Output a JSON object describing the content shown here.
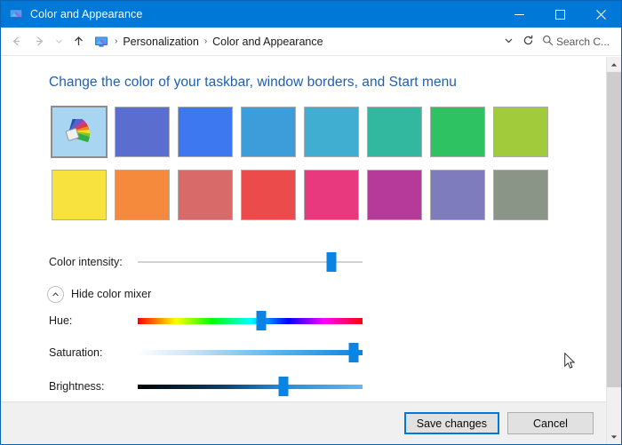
{
  "window": {
    "title": "Color and Appearance",
    "title_icon": "display-monitor-icon",
    "minimize_label": "─",
    "maximize_label": "☐",
    "close_label": "✕"
  },
  "navbar": {
    "back_label": "←",
    "forward_label": "→",
    "recent_label": "⌄",
    "up_label": "↑",
    "crumb_icon": "control-panel-icon",
    "separator": "›",
    "breadcrumbs": [
      "Personalization",
      "Color and Appearance"
    ],
    "dropdown_label": "⌄",
    "refresh_label": "↻",
    "search_icon": "search-icon",
    "search_text": "Search C..."
  },
  "main": {
    "heading": "Change the color of your taskbar, window borders, and Start menu",
    "custom_swatch_name": "custom-color-picker",
    "swatches": [
      {
        "name": "custom",
        "color": "#a8d5f2",
        "selected": true
      },
      {
        "name": "indigo",
        "color": "#5a6ed0",
        "selected": false
      },
      {
        "name": "blue",
        "color": "#3d78f0",
        "selected": false
      },
      {
        "name": "sky-blue",
        "color": "#3d9ddb",
        "selected": false
      },
      {
        "name": "light-blue",
        "color": "#40aed1",
        "selected": false
      },
      {
        "name": "teal",
        "color": "#33b8a0",
        "selected": false
      },
      {
        "name": "green",
        "color": "#2fc262",
        "selected": false
      },
      {
        "name": "lime-green",
        "color": "#a2cb3b",
        "selected": false
      },
      {
        "name": "yellow",
        "color": "#f8e23e",
        "selected": false
      },
      {
        "name": "orange",
        "color": "#f58a3c",
        "selected": false
      },
      {
        "name": "salmon",
        "color": "#d96a6a",
        "selected": false
      },
      {
        "name": "red",
        "color": "#ec4b4b",
        "selected": false
      },
      {
        "name": "pink",
        "color": "#e8397f",
        "selected": false
      },
      {
        "name": "magenta",
        "color": "#b53a99",
        "selected": false
      },
      {
        "name": "purple",
        "color": "#7f7cbd",
        "selected": false
      },
      {
        "name": "sage-gray",
        "color": "#8a9487",
        "selected": false
      }
    ],
    "intensity": {
      "label": "Color intensity:",
      "value_percent": 86,
      "track_color": "#d2d2d2",
      "thumb_color": "#0a84e0"
    },
    "mixer_toggle": {
      "label": "Hide color mixer",
      "icon": "chevron-up-icon",
      "expanded": true
    },
    "mixer_sliders": [
      {
        "name": "hue",
        "label": "Hue:",
        "value_percent": 55,
        "thumb_color": "#0a84e0"
      },
      {
        "name": "saturation",
        "label": "Saturation:",
        "value_percent": 96,
        "thumb_color": "#0a84e0"
      },
      {
        "name": "brightness",
        "label": "Brightness:",
        "value_percent": 65,
        "thumb_color": "#0a84e0"
      }
    ]
  },
  "footer": {
    "save_label": "Save changes",
    "cancel_label": "Cancel"
  },
  "scrollbar": {
    "up_label": "▲",
    "down_label": "▼"
  }
}
